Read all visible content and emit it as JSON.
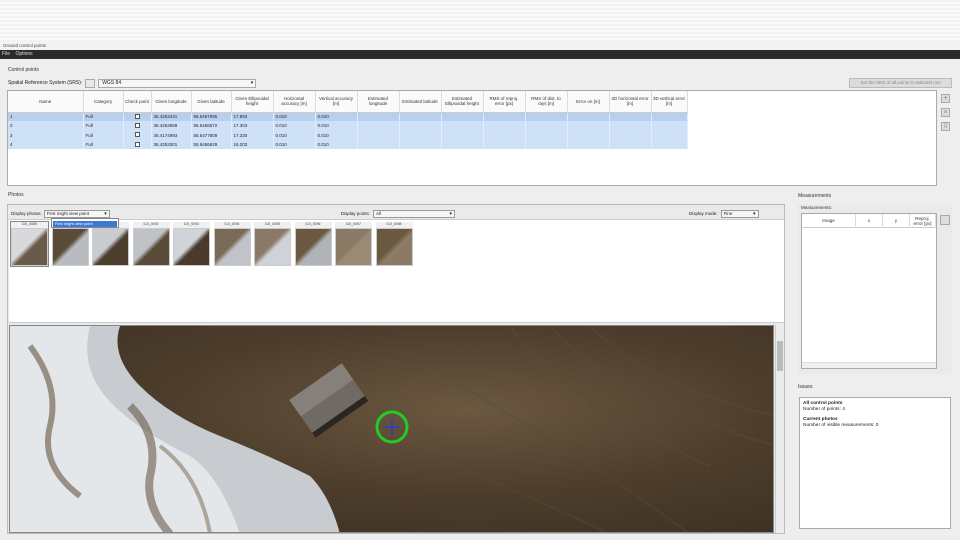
{
  "window": {
    "title": "Ground control points",
    "menu": [
      "File",
      "Options"
    ]
  },
  "gcp_section": {
    "label": "Control points",
    "srs_label": "Spatial Reference System (SRS):",
    "srs_value": "WGS 84",
    "set_srs_button": "Set the SRS of all points in selected row",
    "columns": [
      "Name",
      "Category",
      "Check point",
      "Given longitude",
      "Given latitude",
      "Given Ellipsoidal height",
      "Horizontal accuracy [m]",
      "Vertical accuracy [m]",
      "Estimated longitude",
      "Estimated latitude",
      "Estimated Ellipsoidal height",
      "RMS of reproj. error [px]",
      "RMS of dist. to rays [m]",
      "Error on [m]",
      "3D horizontal error [m]",
      "3D vertical error [m]"
    ],
    "rows": [
      {
        "name": "1",
        "category": "Full",
        "check": "☐",
        "lon": "36.4253431",
        "lat": "55.5457995",
        "h": "17.893",
        "hacc": "0.010",
        "vacc": "0.010"
      },
      {
        "name": "2",
        "category": "Full",
        "check": "☐",
        "lon": "36.4253659",
        "lat": "55.5466572",
        "h": "17.303",
        "hacc": "0.010",
        "vacc": "0.010"
      },
      {
        "name": "3",
        "category": "Full",
        "check": "☐",
        "lon": "36.4174993",
        "lat": "55.5477808",
        "h": "17.330",
        "hacc": "0.010",
        "vacc": "0.010"
      },
      {
        "name": "4",
        "category": "Full",
        "check": "☐",
        "lon": "36.4253301",
        "lat": "55.5466629",
        "h": "16.203",
        "hacc": "0.010",
        "vacc": "0.010"
      }
    ],
    "side_icons": [
      "add-icon",
      "remove-icon",
      "import-icon"
    ]
  },
  "photos_section": {
    "label": "Photos",
    "display_photos_label": "Display photos:",
    "display_photos_value": "First might view point",
    "dropdown_option": "First might view point",
    "display_points_label": "Display points:",
    "display_points_value": "All",
    "display_mode_label": "Display mode:",
    "display_mode_value": "Fine",
    "thumbnails": [
      "DJI_0089",
      "DJI_0090",
      "DJI_0091",
      "DJI_0092",
      "DJI_0093",
      "DJI_0094",
      "DJI_0095",
      "DJI_0096",
      "DJI_0097",
      "DJI_0098"
    ]
  },
  "measurements_section": {
    "label": "Measurements",
    "sub_label": "Measurements:",
    "columns": [
      "Image",
      "x",
      "y",
      "Reproj. error [px]"
    ]
  },
  "issues_section": {
    "label": "Issues",
    "lines": [
      {
        "head": "All control points",
        "body": "Number of points: 4"
      },
      {
        "head": "Current photos",
        "body": "Number of visible measurements: 0"
      }
    ]
  },
  "colors": {
    "selection": "#cfe1f7",
    "marker": "#22cc22",
    "menubar": "#2b2b2b"
  }
}
